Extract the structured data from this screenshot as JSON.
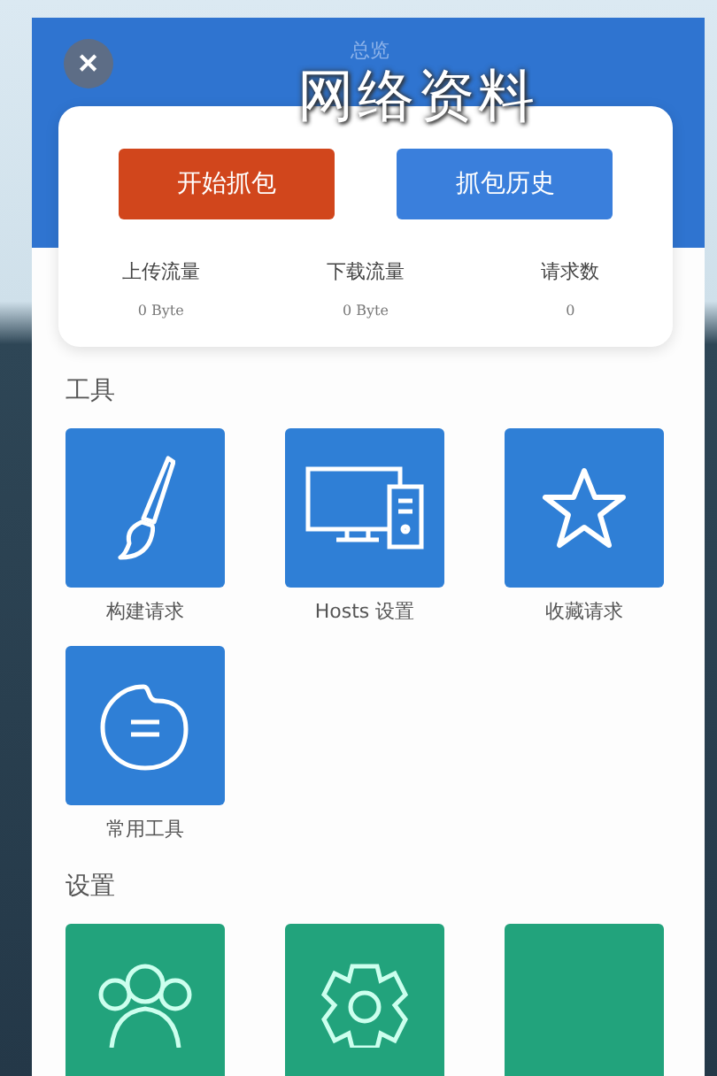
{
  "header": {
    "title": "总览",
    "close_icon": "✕"
  },
  "caption": "网络资料",
  "actions": [
    {
      "label": "开始抓包",
      "kind": "primary"
    },
    {
      "label": "抓包历史",
      "kind": "secondary"
    }
  ],
  "stats": [
    {
      "label": "上传流量",
      "value": "0 Byte"
    },
    {
      "label": "下载流量",
      "value": "0 Byte"
    },
    {
      "label": "请求数",
      "value": "0"
    }
  ],
  "sections": [
    {
      "title": "工具",
      "color": "#2f7fd6",
      "items": [
        {
          "label": "构建请求",
          "kind": "brush"
        },
        {
          "label": "Hosts 设置",
          "kind": "computer"
        },
        {
          "label": "收藏请求",
          "kind": "star"
        },
        {
          "label": "常用工具",
          "kind": "palette"
        }
      ]
    },
    {
      "title": "设置",
      "color": "#22a37c",
      "items": [
        {
          "kind": "people"
        },
        {
          "kind": "gear"
        },
        {
          "kind": "blank"
        }
      ]
    }
  ]
}
